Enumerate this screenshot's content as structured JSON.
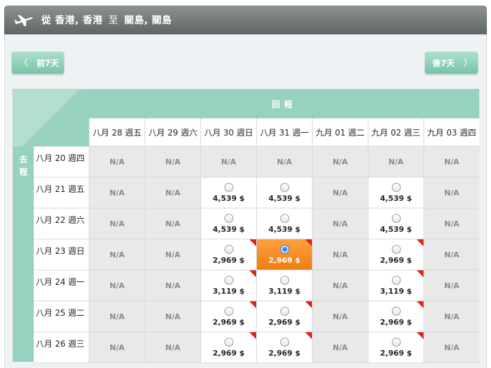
{
  "header": {
    "from_prefix": "從",
    "origin": "香港, 香港",
    "to_word": "至",
    "destination": "關島, 關島"
  },
  "nav": {
    "prev_label": "前7天",
    "next_label": "後7天"
  },
  "grid": {
    "return_label": "回程",
    "depart_label": [
      "去",
      "程"
    ],
    "return_dates": [
      "八月 28 週五",
      "八月 29 週六",
      "八月 30 週日",
      "八月 31 週一",
      "九月 01 週二",
      "九月 02 週三",
      "九月 03 週四"
    ],
    "depart_dates": [
      "八月 20 週四",
      "八月 21 週五",
      "八月 22 週六",
      "八月 23 週日",
      "八月 24 週一",
      "八月 25 週二",
      "八月 26 週三"
    ],
    "na_text": "N/A",
    "rows": [
      [
        {
          "status": "na"
        },
        {
          "status": "na"
        },
        {
          "status": "na"
        },
        {
          "status": "na"
        },
        {
          "status": "na"
        },
        {
          "status": "na"
        },
        {
          "status": "na"
        }
      ],
      [
        {
          "status": "na"
        },
        {
          "status": "na"
        },
        {
          "status": "avail",
          "price": "4,539 $",
          "flag": false
        },
        {
          "status": "avail",
          "price": "4,539 $",
          "flag": false
        },
        {
          "status": "na"
        },
        {
          "status": "avail",
          "price": "4,539 $",
          "flag": false
        },
        {
          "status": "na"
        }
      ],
      [
        {
          "status": "na"
        },
        {
          "status": "na"
        },
        {
          "status": "avail",
          "price": "4,539 $",
          "flag": false
        },
        {
          "status": "avail",
          "price": "4,539 $",
          "flag": false
        },
        {
          "status": "na"
        },
        {
          "status": "avail",
          "price": "4,539 $",
          "flag": false
        },
        {
          "status": "na"
        }
      ],
      [
        {
          "status": "na"
        },
        {
          "status": "na"
        },
        {
          "status": "avail",
          "price": "2,969 $",
          "flag": true
        },
        {
          "status": "selected",
          "price": "2,969 $",
          "flag": true
        },
        {
          "status": "na"
        },
        {
          "status": "avail",
          "price": "2,969 $",
          "flag": true
        },
        {
          "status": "na"
        }
      ],
      [
        {
          "status": "na"
        },
        {
          "status": "na"
        },
        {
          "status": "avail",
          "price": "3,119 $",
          "flag": true
        },
        {
          "status": "avail",
          "price": "3,119 $",
          "flag": false
        },
        {
          "status": "na"
        },
        {
          "status": "avail",
          "price": "3,119 $",
          "flag": true
        },
        {
          "status": "na"
        }
      ],
      [
        {
          "status": "na"
        },
        {
          "status": "na"
        },
        {
          "status": "avail",
          "price": "2,969 $",
          "flag": true
        },
        {
          "status": "avail",
          "price": "2,969 $",
          "flag": true
        },
        {
          "status": "na"
        },
        {
          "status": "avail",
          "price": "2,969 $",
          "flag": true
        },
        {
          "status": "na"
        }
      ],
      [
        {
          "status": "na"
        },
        {
          "status": "na"
        },
        {
          "status": "avail",
          "price": "2,969 $",
          "flag": true
        },
        {
          "status": "avail",
          "price": "2,969 $",
          "flag": true
        },
        {
          "status": "na"
        },
        {
          "status": "avail",
          "price": "2,969 $",
          "flag": true
        },
        {
          "status": "na"
        }
      ]
    ]
  },
  "colors": {
    "header_bg": "#6f7475",
    "accent_green": "#96d2bf",
    "selected_orange": "#f5871e",
    "na_bg": "#e9e9e9",
    "flag_red": "#e0221b"
  },
  "icons": {
    "header": "airplane-icon",
    "prev": "chevron-left-icon",
    "next": "chevron-right-icon",
    "cell_select": "radio-icon",
    "cell_marker": "red-corner-flag-icon"
  }
}
